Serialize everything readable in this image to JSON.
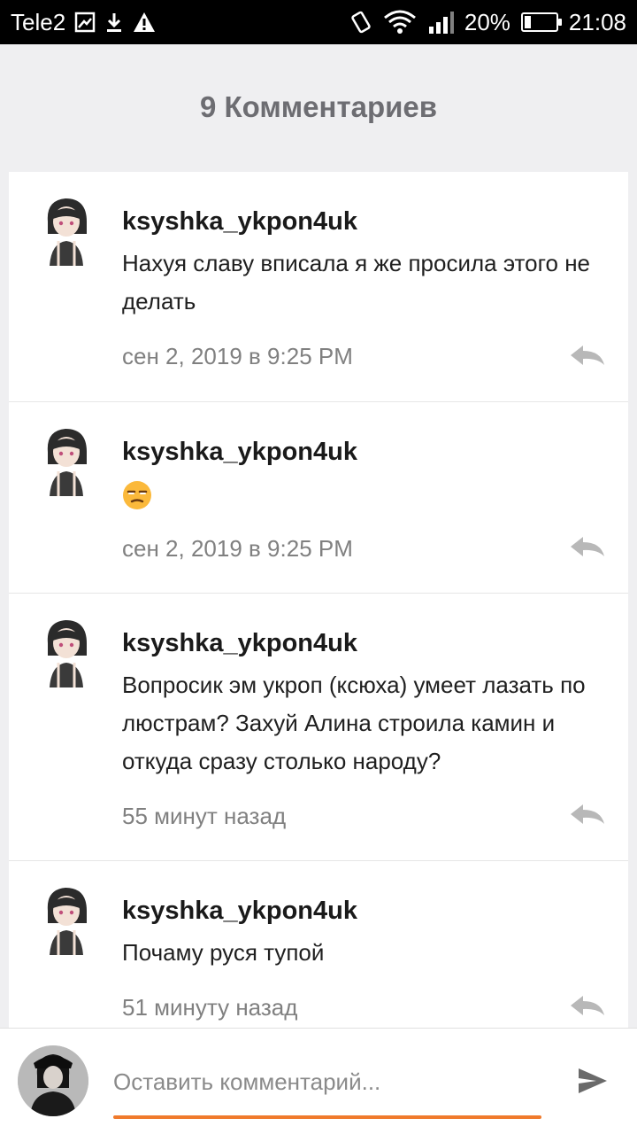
{
  "status_bar": {
    "carrier": "Tele2",
    "battery_percent": "20%",
    "battery_level": 0.2,
    "time": "21:08",
    "icons": [
      "photo-icon",
      "download-icon",
      "warning-icon",
      "vibrate-icon",
      "wifi-icon",
      "signal-icon",
      "battery-icon"
    ]
  },
  "header": {
    "title": "9 Комментариев"
  },
  "comments": [
    {
      "username": "ksyshka_ykpon4uk",
      "text": "Нахуя славу вписала я же просила этого не делать",
      "time": "сен 2, 2019 в 9:25 PM"
    },
    {
      "username": "ksyshka_ykpon4uk",
      "text": "",
      "emoji": "unamused-face",
      "time": "сен 2, 2019 в 9:25 PM"
    },
    {
      "username": "ksyshka_ykpon4uk",
      "text": "Вопросик эм укроп (ксюха) умеет лазать по люстрам? Захуй Алина строила камин и откуда сразу столько народу?",
      "time": "55 минут назад"
    },
    {
      "username": "ksyshka_ykpon4uk",
      "text": "Почаму руся тупой",
      "time": "51 минуту назад"
    }
  ],
  "input": {
    "placeholder": "Оставить комментарий...",
    "accent_color": "#f07a2c"
  }
}
